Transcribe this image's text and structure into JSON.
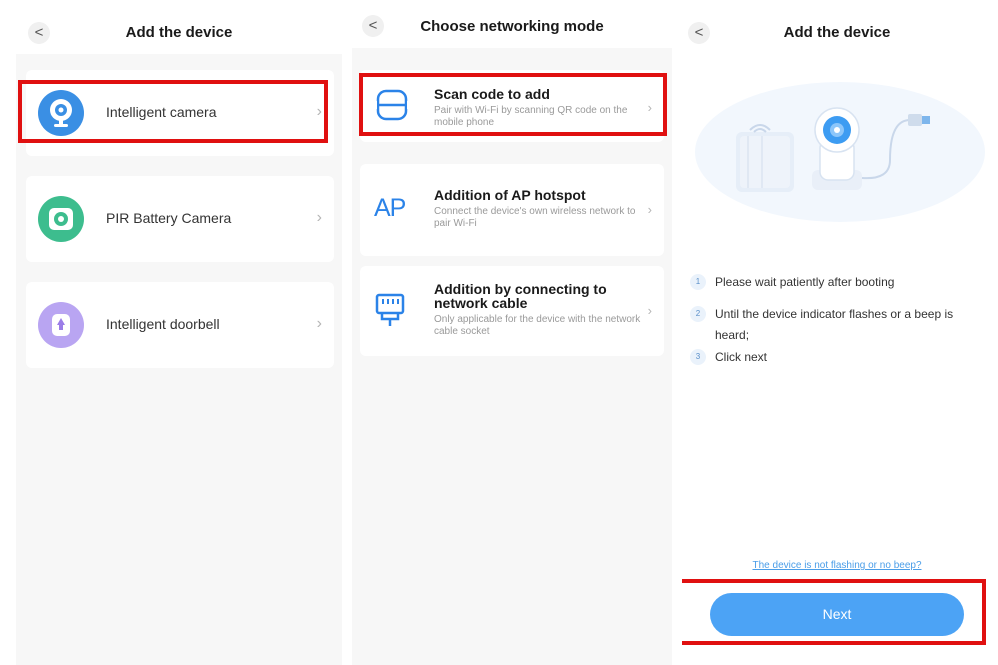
{
  "screen1": {
    "title": "Add the device",
    "back_icon": "<",
    "items": [
      {
        "label": "Intelligent camera",
        "icon": "camera-icon",
        "color": "#3a8fe4"
      },
      {
        "label": "PIR Battery Camera",
        "icon": "battery-camera-icon",
        "color": "#3dbd8e"
      },
      {
        "label": "Intelligent doorbell",
        "icon": "doorbell-icon",
        "color": "#9b7de8"
      }
    ],
    "chevron": "›"
  },
  "screen2": {
    "title": "Choose networking mode",
    "back_icon": "<",
    "modes": [
      {
        "title": "Scan code to add",
        "desc": "Pair with Wi-Fi by scanning QR code on the mobile phone",
        "icon": "scan-icon"
      },
      {
        "title": "Addition of AP hotspot",
        "desc": "Connect the device's own wireless network to pair Wi-Fi",
        "icon": "ap-icon",
        "icon_text": "AP"
      },
      {
        "title": "Addition by connecting to network cable",
        "desc": "Only applicable for the device with the network cable socket",
        "icon": "ethernet-icon"
      }
    ],
    "chevron": "›"
  },
  "screen3": {
    "title": "Add the device",
    "back_icon": "<",
    "steps": [
      {
        "num": "1",
        "text": "Please wait patiently after booting"
      },
      {
        "num": "2",
        "text": "Until the device indicator flashes or a beep is heard;"
      },
      {
        "num": "3",
        "text": "Click next"
      }
    ],
    "help_link": "The device is not flashing or no beep?",
    "next_label": "Next"
  },
  "colors": {
    "highlight": "#e01010",
    "accent": "#4ca3f5"
  }
}
